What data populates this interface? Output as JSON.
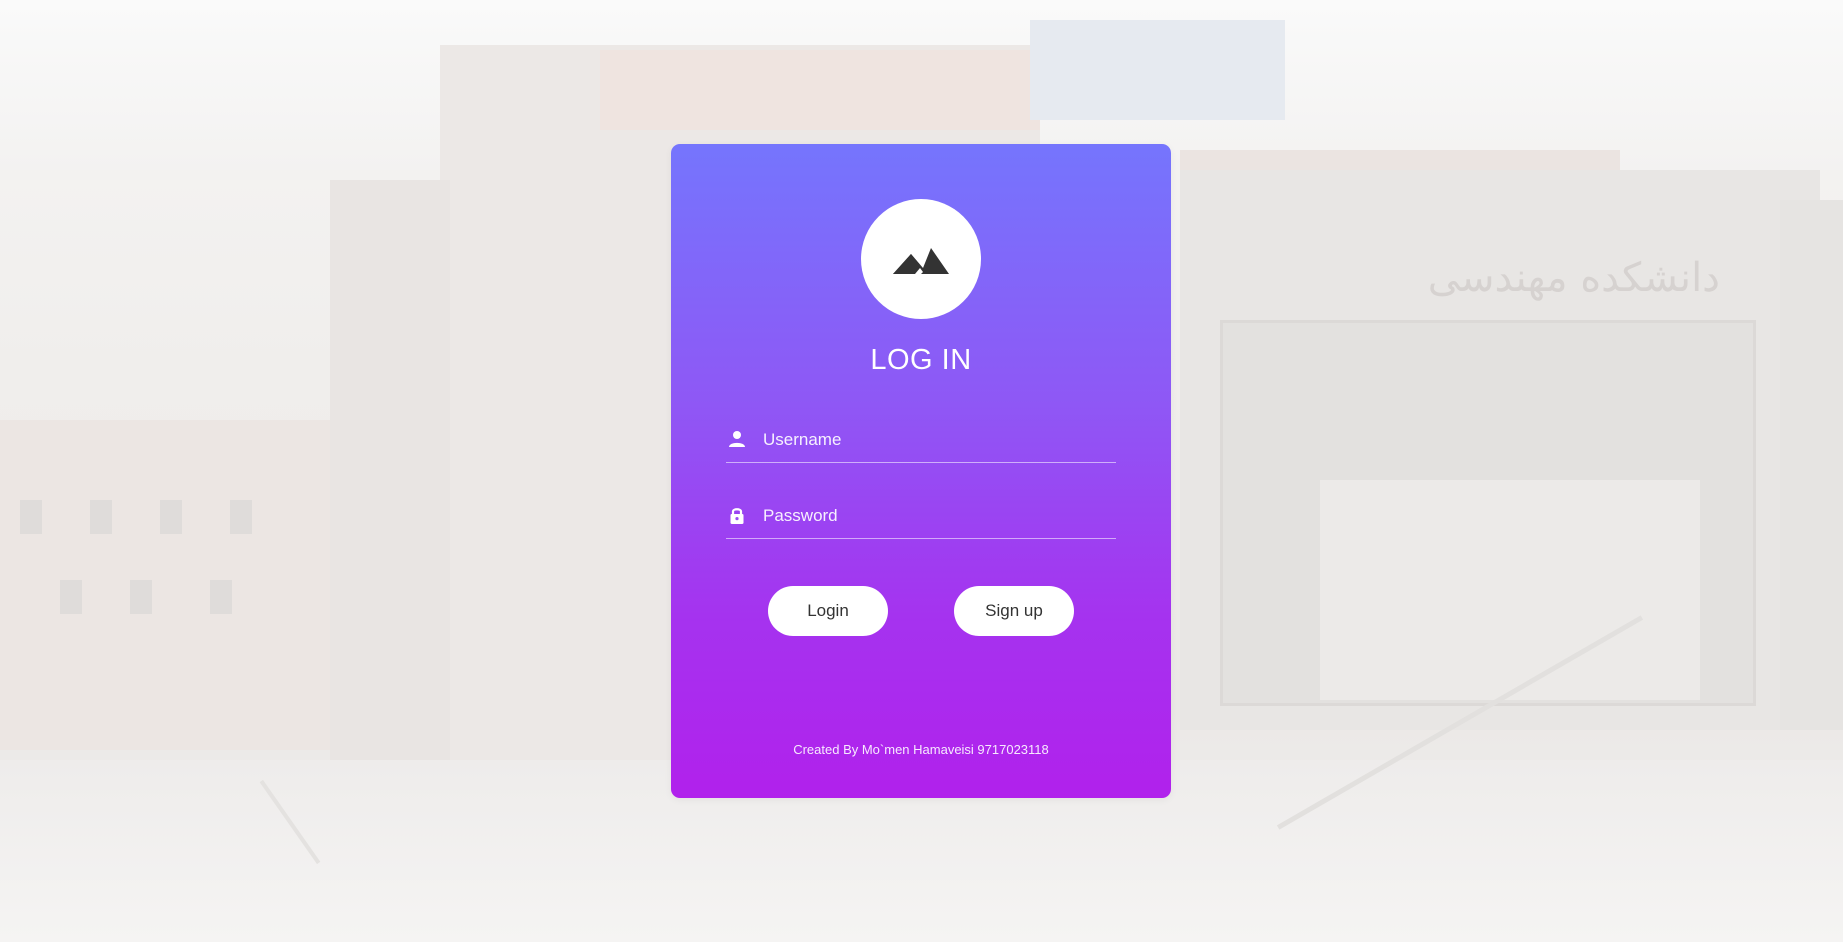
{
  "login_form": {
    "title": "LOG IN",
    "username": {
      "placeholder": "Username",
      "value": ""
    },
    "password": {
      "placeholder": "Password",
      "value": ""
    },
    "login_label": "Login",
    "signup_label": "Sign up",
    "credit": "Created By Mo`men Hamaveisi 9717023118"
  },
  "background": {
    "sign_text": "دانشکده مهندسی"
  },
  "icons": {
    "logo": "mountain-icon",
    "username": "user-icon",
    "password": "lock-icon"
  },
  "colors": {
    "card_gradient_top": "#7575fd",
    "card_gradient_bottom": "#b121ec",
    "button_bg": "#ffffff",
    "button_text": "#333333",
    "icon_dark": "#333333"
  }
}
